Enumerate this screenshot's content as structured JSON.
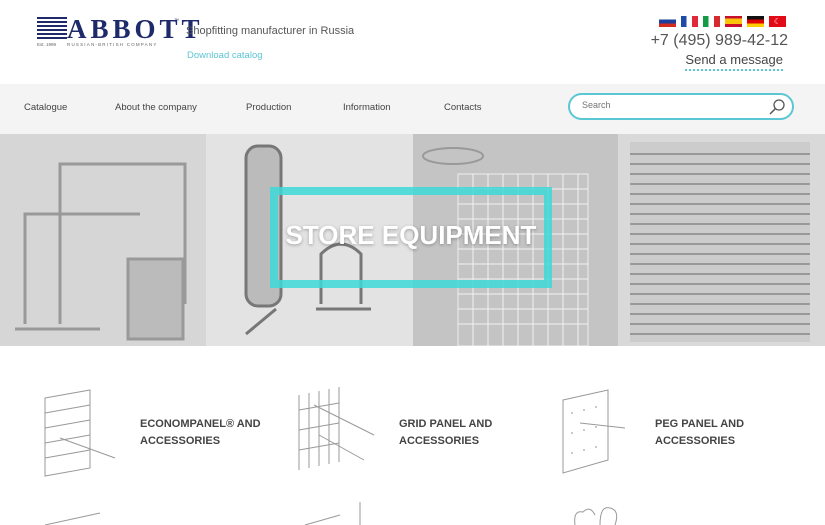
{
  "header": {
    "logo_text": "ABBOTT",
    "logo_est": "Est. 1999",
    "logo_sub": "RUSSIAN-BRITISH COMPANY",
    "tagline": "Shopfitting manufacturer in Russia",
    "download": "Download catalog",
    "phone": "+7 (495) 989-42-12",
    "send_message": "Send a message",
    "flags": [
      "ru",
      "fr",
      "it",
      "es",
      "de",
      "tr"
    ]
  },
  "nav": {
    "items": [
      "Catalogue",
      "About the company",
      "Production",
      "Information",
      "Contacts"
    ],
    "search_placeholder": "Search"
  },
  "hero": {
    "title": "STORE EQUIPMENT"
  },
  "categories": [
    {
      "label": "ECONOMPANEL® AND ACCESSORIES"
    },
    {
      "label": "GRID PANEL AND ACCESSORIES"
    },
    {
      "label": "PEG PANEL AND ACCESSORIES"
    }
  ],
  "colors": {
    "accent": "#5bc6d4",
    "brand": "#1f2a6b"
  }
}
